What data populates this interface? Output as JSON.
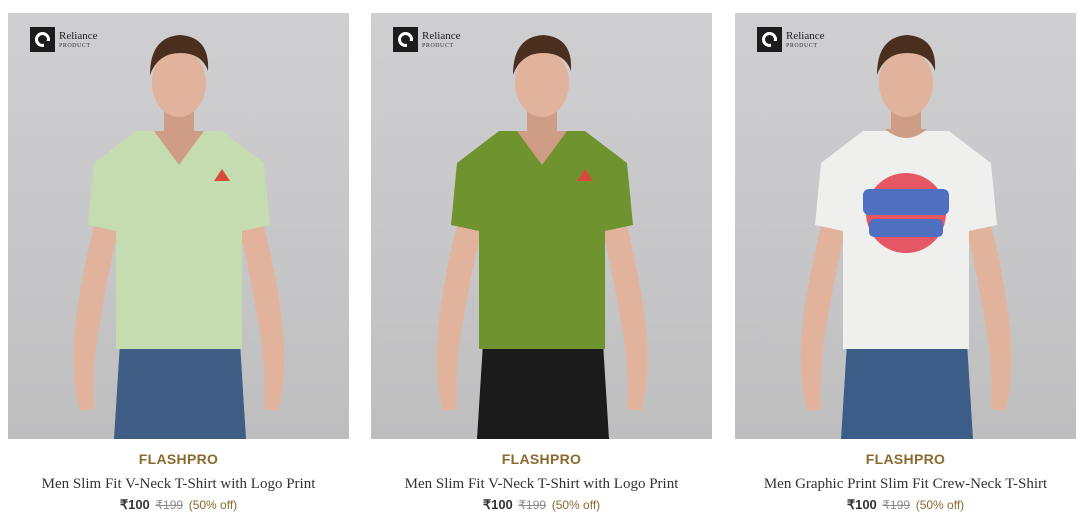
{
  "products": [
    {
      "badge": {
        "name": "Reliance",
        "sub": "PRODUCT"
      },
      "brand": "FLASHPRO",
      "title": "Men Slim Fit V-Neck T-Shirt with Logo Print",
      "price": "₹100",
      "mrp": "₹199",
      "discount": "(50% off)",
      "shirt_color": "#c4dcb0",
      "pants_color": "#3f5d85",
      "neck": "v",
      "graphic": "small-logo"
    },
    {
      "badge": {
        "name": "Reliance",
        "sub": "PRODUCT"
      },
      "brand": "FLASHPRO",
      "title": "Men Slim Fit V-Neck T-Shirt with Logo Print",
      "price": "₹100",
      "mrp": "₹199",
      "discount": "(50% off)",
      "shirt_color": "#6f932f",
      "pants_color": "#1b1b1b",
      "neck": "v",
      "graphic": "small-logo"
    },
    {
      "badge": {
        "name": "Reliance",
        "sub": "PRODUCT"
      },
      "brand": "FLASHPRO",
      "title": "Men Graphic Print Slim Fit Crew-Neck T-Shirt",
      "price": "₹100",
      "mrp": "₹199",
      "discount": "(50% off)",
      "shirt_color": "#efefed",
      "pants_color": "#3d5d89",
      "neck": "crew",
      "graphic": "chest-print"
    }
  ]
}
